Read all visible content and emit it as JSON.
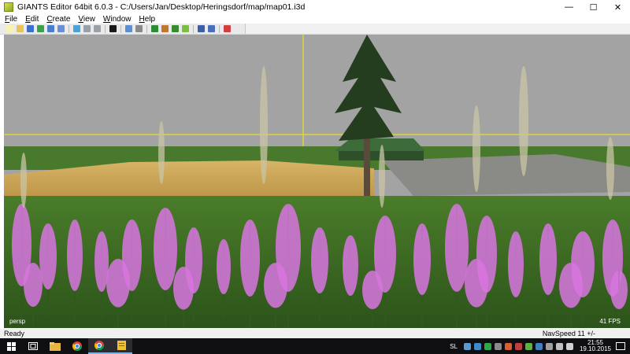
{
  "window": {
    "title": "GIANTS Editor 64bit 6.0.3 - C:/Users/Jan/Desktop/Heringsdorf/map/map01.i3d",
    "minimize": "—",
    "maximize": "☐",
    "close": "✕"
  },
  "menu": [
    {
      "accel": "F",
      "rest": "ile"
    },
    {
      "accel": "E",
      "rest": "dit"
    },
    {
      "accel": "C",
      "rest": "reate"
    },
    {
      "accel": "V",
      "rest": "iew"
    },
    {
      "accel": "W",
      "rest": "indow"
    },
    {
      "accel": "H",
      "rest": "elp"
    }
  ],
  "toolbar": {
    "icons": [
      "new-file-icon",
      "open-file-icon",
      "save-icon",
      "refresh-icon",
      "save-as-icon",
      "export-icon",
      "history-icon",
      "undo-icon",
      "redo-icon",
      "stop-icon",
      "camera-icon",
      "magnet-icon",
      "terrain-paint-icon",
      "terrain-sculpt-icon",
      "foliage-paint-icon",
      "foliage-icon",
      "settings-icon",
      "settings-alt-icon",
      "delete-icon"
    ],
    "colors": [
      "#f7f2b0",
      "#e8c35a",
      "#3e6fc9",
      "#3aa24a",
      "#4a7fd0",
      "#6b8fd6",
      "#4aa3d8",
      "#9aa0a8",
      "#9aa0a8",
      "#1a1a1a",
      "#5c8ed4",
      "#8a8a8a",
      "#2f8a3a",
      "#c0762f",
      "#3a8a2f",
      "#7bbf3f",
      "#3a5fa8",
      "#4a6fb8",
      "#d04040"
    ]
  },
  "viewport": {
    "camera_label": "persp",
    "fps_label": "41 FPS",
    "sky_color": "#a3a3a3",
    "ground_color": "#3c6b1f",
    "flower_color": "#d876e0"
  },
  "status": {
    "left": "Ready",
    "right": "NavSpeed 11 +/-"
  },
  "taskbar": {
    "apps": [
      "windows-start-icon",
      "task-view-icon",
      "file-explorer-icon",
      "chrome-icon",
      "chrome-alt-icon",
      "sticky-notes-icon"
    ],
    "tray_lang": "SL",
    "clock_time": "21:55",
    "clock_date": "19.10.2015"
  }
}
